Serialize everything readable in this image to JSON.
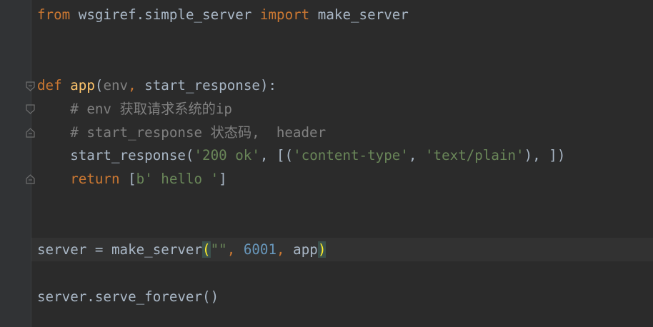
{
  "colors": {
    "background": "#2b2b2b",
    "gutter": "#313335",
    "keyword": "#cc7832",
    "function": "#ffc66d",
    "string": "#6a8759",
    "number": "#6897bb",
    "comment": "#808080",
    "text": "#a9b7c6",
    "brace_highlight": "#ffef28"
  },
  "code": {
    "line1": {
      "kw_from": "from",
      "module": " wsgiref.simple_server ",
      "kw_import": "import",
      "name": " make_server"
    },
    "line4": {
      "kw_def": "def",
      "sp": " ",
      "fn_name": "app",
      "open": "(",
      "param_env": "env",
      "comma": ", ",
      "param_sr": "start_response",
      "close": "):"
    },
    "line5": {
      "indent": "    ",
      "comment": "# env 获取请求系统的ip"
    },
    "line6": {
      "indent": "    ",
      "comment": "# start_response 状态码,  header"
    },
    "line7": {
      "call": "    start_response(",
      "str1": "'200 ok'",
      "sep1": ", [(",
      "str2": "'content-type'",
      "sep2": ", ",
      "str3": "'text/plain'",
      "end": "), ])"
    },
    "line8": {
      "indent": "    ",
      "kw_return": "return",
      "open": " [",
      "bytes": "b' hello '",
      "close": "]"
    },
    "line11": {
      "prefix": "server = make_server",
      "open": "(",
      "str_empty": "\"\"",
      "comma1": ", ",
      "port": "6001",
      "comma2": ", ",
      "arg_app": "app",
      "close": ")"
    },
    "line13": {
      "text": "server.serve_forever()"
    }
  },
  "icons": {
    "fold_start": "fold-start-icon",
    "fold_end": "fold-end-icon"
  }
}
